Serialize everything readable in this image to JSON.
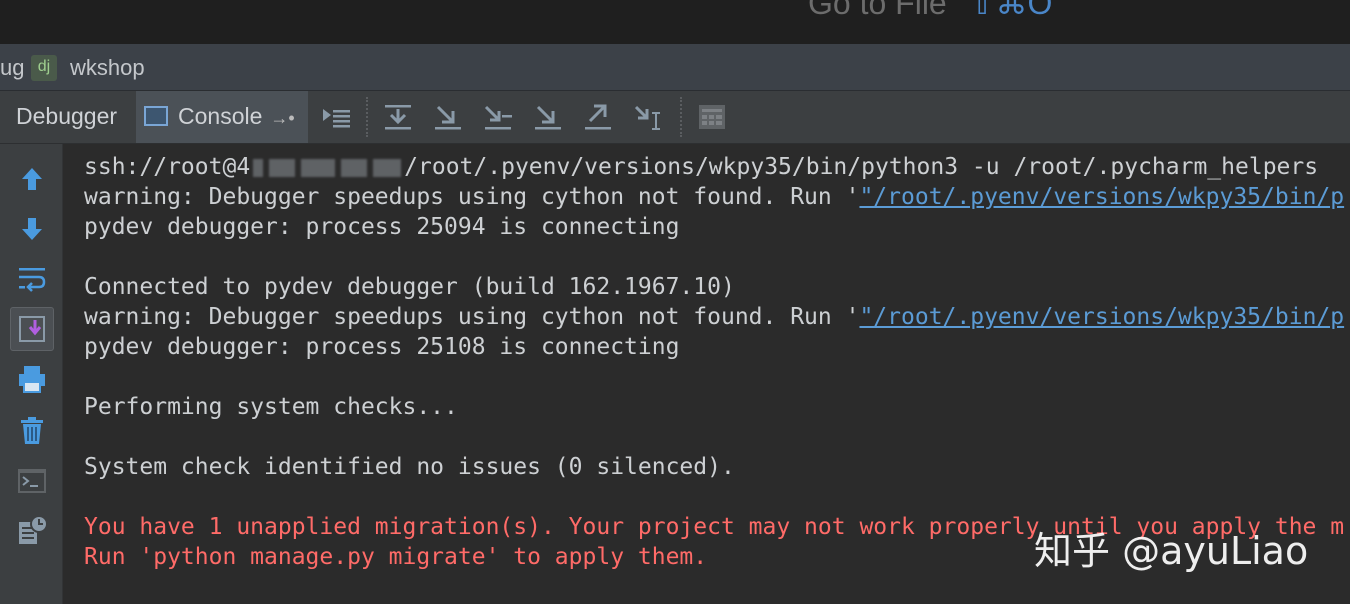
{
  "top_hint": {
    "text": "Go to File",
    "shortcut": "⇧⌘O"
  },
  "title_bar": {
    "prefix": "ug",
    "django_badge": "dj",
    "project": "wkshop"
  },
  "tabs": {
    "debugger": "Debugger",
    "console": "Console",
    "pin_glyph": "→•"
  },
  "console": {
    "line1_a": "ssh://root@4",
    "line1_b": "/root/.pyenv/versions/wkpy35/bin/python3 -u /root/.pycharm_helpers",
    "warn_prefix": "warning: Debugger speedups using cython not found. Run '",
    "warn_link": "\"/root/.pyenv/versions/wkpy35/bin/p",
    "pydev1": "pydev debugger: process 25094 is connecting",
    "connected": "Connected to pydev debugger (build 162.1967.10)",
    "pydev2": "pydev debugger: process 25108 is connecting",
    "checks": "Performing system checks...",
    "identified": "System check identified no issues (0 silenced).",
    "err1": "You have 1 unapplied migration(s). Your project may not work properly until you apply the m",
    "err2": "Run 'python manage.py migrate' to apply them."
  },
  "watermark": "知乎 @ayuLiao",
  "colors": {
    "error": "#ff6b68",
    "link": "#5b9bd5",
    "text": "#cdd0d3",
    "background": "#2b2b2b"
  }
}
